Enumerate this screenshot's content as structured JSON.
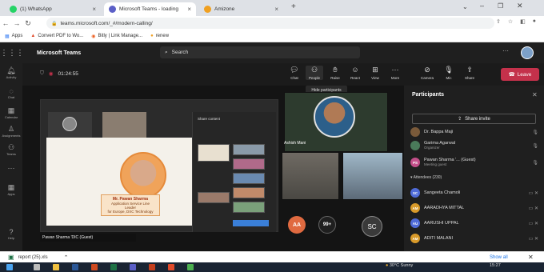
{
  "browser": {
    "tabs": [
      {
        "title": "(1) WhatsApp",
        "color": "#25d366",
        "active": false
      },
      {
        "title": "Microsoft Teams - loading",
        "color": "#5b5fc7",
        "active": true
      },
      {
        "title": "Amizone",
        "color": "#f0a020",
        "active": false
      }
    ],
    "new_tab": "+",
    "url": "teams.microsoft.com/_#/modern-calling/",
    "bookmarks": [
      {
        "label": "Apps"
      },
      {
        "label": "Convert PDF to Wo..."
      },
      {
        "label": "Bitly | Link Manage..."
      },
      {
        "label": "renew"
      }
    ]
  },
  "teams": {
    "app_title": "Microsoft Teams",
    "search_placeholder": "Search",
    "rail": [
      {
        "label": "Activity",
        "icon": "bell-icon"
      },
      {
        "label": "Chat",
        "icon": "chat-icon"
      },
      {
        "label": "Calendar",
        "icon": "calendar-icon"
      },
      {
        "label": "Assignments",
        "icon": "assignments-icon"
      },
      {
        "label": "Teams",
        "icon": "teams-icon"
      },
      {
        "label": "",
        "icon": "more-icon"
      },
      {
        "label": "Apps",
        "icon": "apps-icon"
      },
      {
        "label": "Help",
        "icon": "help-icon"
      }
    ]
  },
  "meeting": {
    "timer": "01:24:55",
    "toolbar": [
      {
        "label": "Chat",
        "icon": "chat-icon"
      },
      {
        "label": "People",
        "icon": "people-icon"
      },
      {
        "label": "Raise",
        "icon": "hand-icon"
      },
      {
        "label": "React",
        "icon": "react-icon"
      },
      {
        "label": "View",
        "icon": "view-icon"
      },
      {
        "label": "More",
        "icon": "more-icon"
      },
      {
        "label": "Camera",
        "icon": "camera-off-icon"
      },
      {
        "label": "Mic",
        "icon": "mic-off-icon"
      },
      {
        "label": "Share",
        "icon": "share-icon"
      }
    ],
    "leave_label": "Leave",
    "tooltip": "Hide participants",
    "presenter_name": "Pawan Sharma 'DIC (Guest)",
    "slide": {
      "name": "Mr. Pawan Sharma",
      "role_line1": "Application Service Line",
      "role_line2": "Leader",
      "role_line3": "for Europe, DXC Technology"
    },
    "share_panel_title": "Share content",
    "tiles": {
      "ashish": "Ashish Mani",
      "aa": "AA",
      "more": "99+",
      "sc": "SC"
    }
  },
  "participants": {
    "title": "Participants",
    "share_invite": "Share invite",
    "people": [
      {
        "name": "Dr. Bappa Maji",
        "sub": "",
        "initials": "",
        "color": "#7a5a3a"
      },
      {
        "name": "Garima Agarwal",
        "sub": "Organizer",
        "initials": "",
        "color": "#4a7a5a"
      },
      {
        "name": "Pawan Sharma '... (Guest)",
        "sub": "Meeting guest",
        "initials": "PS",
        "color": "#c44f8a"
      }
    ],
    "attendees_label": "Attendees (230)",
    "attendees": [
      {
        "name": "Sangeeta Chamoli",
        "initials": "SC",
        "color": "#4f6bd8"
      },
      {
        "name": "AARADHYA MITTAL",
        "initials": "AM",
        "color": "#d89a2a"
      },
      {
        "name": "AARUSHI UPPAL",
        "initials": "AU",
        "color": "#4f6bd8"
      },
      {
        "name": "ADITI MALANI",
        "initials": "AM",
        "color": "#d89a2a"
      }
    ]
  },
  "download_bar": {
    "file": "report (25).xls",
    "show_all": "Show all"
  },
  "taskbar": {
    "weather": "30°C Sunny",
    "time": "15:27"
  }
}
